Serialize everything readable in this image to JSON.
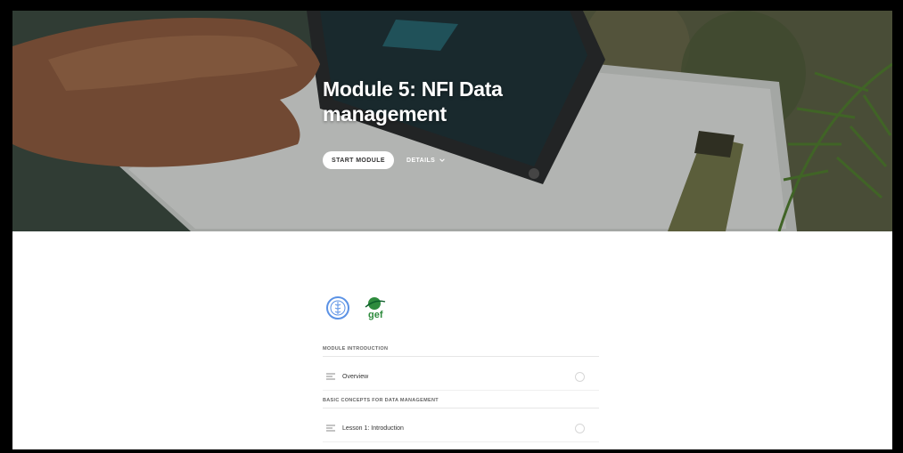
{
  "hero": {
    "title": "Module 5: NFI Data management",
    "start_label": "START MODULE",
    "details_label": "DETAILS"
  },
  "icons": {
    "details": "chevron-down-icon",
    "lesson": "lines-icon",
    "status": "circle-icon"
  },
  "logos": {
    "fao_text": "FAO",
    "gef_text": "gef"
  },
  "sections": [
    {
      "label": "MODULE INTRODUCTION",
      "lessons": [
        {
          "label": "Overview"
        }
      ]
    },
    {
      "label": "BASIC CONCEPTS FOR DATA MANAGEMENT",
      "lessons": [
        {
          "label": "Lesson 1: Introduction"
        }
      ]
    }
  ],
  "colors": {
    "hero_text": "#ffffff",
    "button_bg": "#ffffff",
    "divider": "#e6e6e6",
    "fao_blue": "#5b92e5",
    "gef_green": "#2e8b3d"
  }
}
